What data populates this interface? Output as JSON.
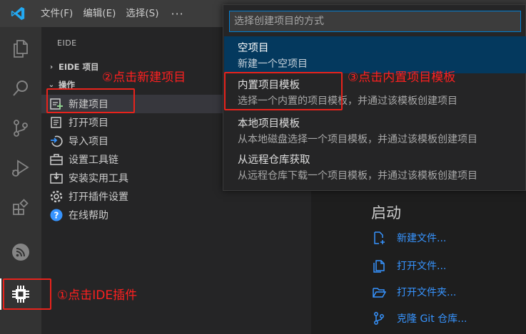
{
  "titlebar": {
    "menus": [
      "文件(F)",
      "编辑(E)",
      "选择(S)"
    ],
    "more": "···"
  },
  "activity_bar": {
    "icons": [
      "explorer-icon",
      "search-icon",
      "source-control-icon",
      "run-debug-icon",
      "extensions-icon",
      "esp-idf-icon",
      "eide-chip-icon"
    ]
  },
  "sidebar": {
    "title": "EIDE",
    "project_section": "EIDE 项目",
    "operations_section": "操作",
    "items": [
      {
        "label": "新建项目",
        "icon": "new-project-icon"
      },
      {
        "label": "打开项目",
        "icon": "open-project-icon"
      },
      {
        "label": "导入项目",
        "icon": "import-project-icon"
      },
      {
        "label": "设置工具链",
        "icon": "toolbox-icon"
      },
      {
        "label": "安装实用工具",
        "icon": "install-tools-icon"
      },
      {
        "label": "打开插件设置",
        "icon": "gear-icon"
      },
      {
        "label": "在线帮助",
        "icon": "help-icon"
      }
    ]
  },
  "quick_pick": {
    "placeholder": "选择创建项目的方式",
    "items": [
      {
        "label": "空项目",
        "description": "新建一个空项目"
      },
      {
        "label": "内置项目模板",
        "description": "选择一个内置的项目模板，并通过该模板创建项目"
      },
      {
        "label": "本地项目模板",
        "description": "从本地磁盘选择一个项目模板，并通过该模板创建项目"
      },
      {
        "label": "从远程仓库获取",
        "description": "从远程仓库下载一个项目模板，并通过该模板创建项目"
      }
    ]
  },
  "welcome": {
    "start_title": "启动",
    "links": [
      "新建文件...",
      "打开文件...",
      "打开文件夹...",
      "克隆 Git 仓库..."
    ]
  },
  "annotations": {
    "step1": "①点击IDE插件",
    "step2": "②点击新建项目",
    "step3": "③点击内置项目模板"
  },
  "colors": {
    "annotation_red": "#e8231c",
    "link_blue": "#3794ff",
    "quickpick_active": "#04395e",
    "focus_border": "#007fd4"
  }
}
